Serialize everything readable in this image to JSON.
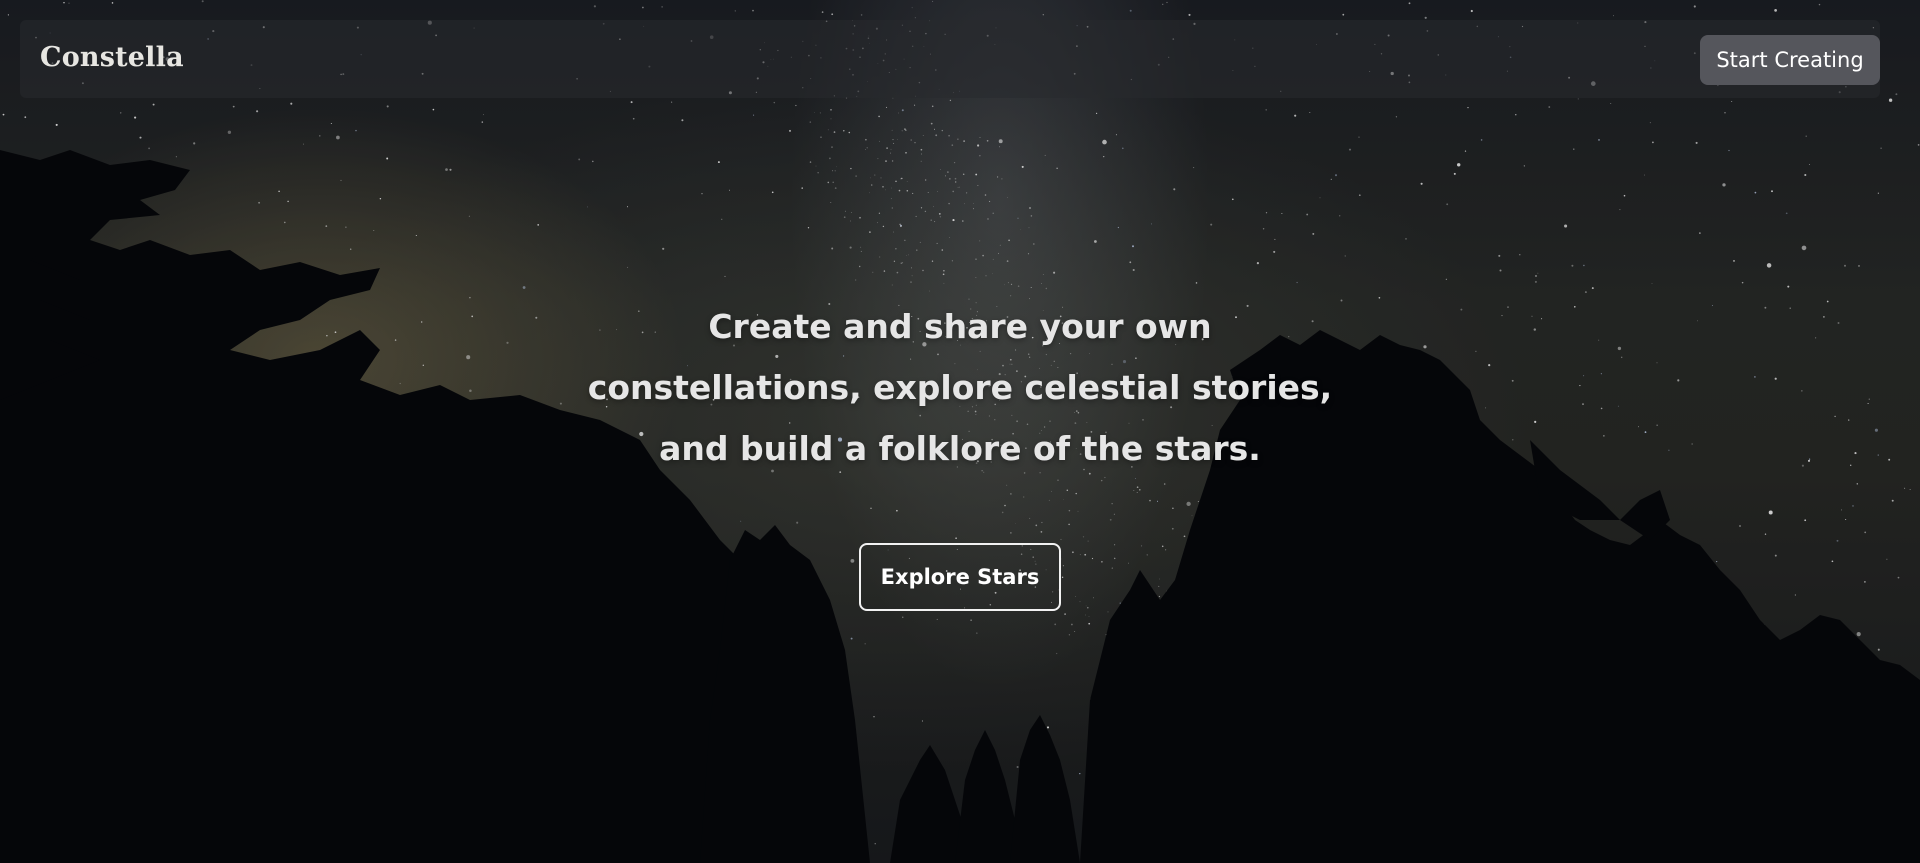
{
  "brand": {
    "name": "Constella"
  },
  "nav": {
    "cta_label": "Start Creating"
  },
  "hero": {
    "lines": [
      "Create and share your own",
      "constellations, explore celestial stories,",
      "and build a folklore of the stars."
    ],
    "button_label": "Explore Stars"
  },
  "background": {
    "subject": "starry night sky with silhouetted trees"
  },
  "colors": {
    "nav_button": "#55565c",
    "text": "#e6e6e6",
    "tree_silhouette": "#07080c"
  }
}
